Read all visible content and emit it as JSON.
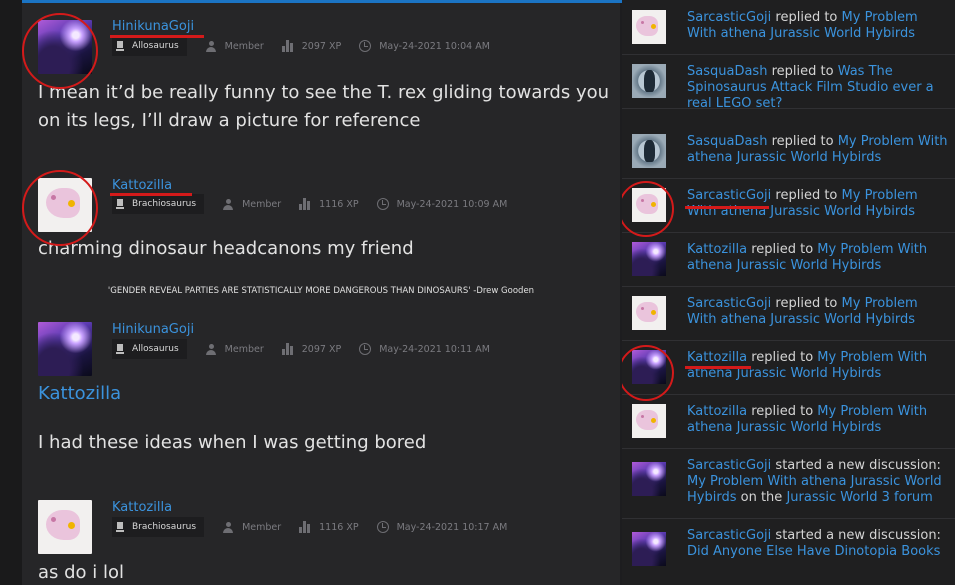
{
  "posts": [
    {
      "username": "HinikunaGoji",
      "rank": "Allosaurus",
      "role": "Member",
      "xp": "2097 XP",
      "timestamp": "May-24-2021 10:04 AM",
      "avatar": "space-avatar",
      "body": [
        "I mean it’d be really funny to see the  T. rex gliding towards you",
        "on its legs, I’ll draw a picture for reference"
      ]
    },
    {
      "username": "Kattozilla",
      "rank": "Brachiosaurus",
      "role": "Member",
      "xp": "1116 XP",
      "timestamp": "May-24-2021 10:09 AM",
      "avatar": "dragon-avatar",
      "body": [
        "charming dinosaur headcanons my friend"
      ],
      "signature": "'GENDER REVEAL PARTIES ARE STATISTICALLY MORE DANGEROUS THAN DINOSAURS' -Drew Gooden"
    },
    {
      "username": "HinikunaGoji",
      "rank": "Allosaurus",
      "role": "Member",
      "xp": "2097 XP",
      "timestamp": "May-24-2021 10:11 AM",
      "avatar": "space-avatar",
      "mention": "Kattozilla",
      "body": [
        "I had these ideas when I was getting bored"
      ]
    },
    {
      "username": "Kattozilla",
      "rank": "Brachiosaurus",
      "role": "Member",
      "xp": "1116 XP",
      "timestamp": "May-24-2021 10:17 AM",
      "avatar": "dragon-avatar",
      "body": [
        "as do i lol"
      ]
    }
  ],
  "activity": [
    {
      "user": "SarcasticGoji",
      "action": "replied to",
      "title": "My Problem With athena Jurassic World Hybirds",
      "avatar": "dragon-avatar"
    },
    {
      "user": "SasquaDash",
      "action": "replied to",
      "title": "Was The Spinosaurus Attack Film Studio ever a real LEGO set?",
      "avatar": "bigfoot-avatar"
    },
    {
      "user": "SasquaDash",
      "action": "replied to",
      "title": "My Problem With athena Jurassic World Hybirds",
      "avatar": "bigfoot-avatar"
    },
    {
      "user": "SarcasticGoji",
      "action": "replied to",
      "title": "My Problem With athena Jurassic World Hybirds",
      "avatar": "dragon-avatar"
    },
    {
      "user": "Kattozilla",
      "action": "replied to",
      "title": "My Problem With athena Jurassic World Hybirds",
      "avatar": "space-avatar"
    },
    {
      "user": "SarcasticGoji",
      "action": "replied to",
      "title": "My Problem With athena Jurassic World Hybirds",
      "avatar": "dragon-avatar"
    },
    {
      "user": "Kattozilla",
      "action": "replied to",
      "title": "My Problem With athena Jurassic World Hybirds",
      "avatar": "space-avatar"
    },
    {
      "user": "Kattozilla",
      "action": "replied to",
      "title": "My Problem With athena Jurassic World Hybirds",
      "avatar": "dragon-avatar"
    },
    {
      "user": "SarcasticGoji",
      "action": "started a new discussion:",
      "title": "My Problem With athena Jurassic World Hybirds",
      "on": "on the",
      "forum": "Jurassic World 3 forum",
      "avatar": "space-avatar"
    },
    {
      "user": "SarcasticGoji",
      "action": "started a new discussion:",
      "title": "Did Anyone Else Have Dinotopia Books",
      "avatar": "space-avatar"
    }
  ],
  "colors": {
    "link": "#3b93dd",
    "annotation": "#d41a1a",
    "accent": "#1b74c4"
  }
}
